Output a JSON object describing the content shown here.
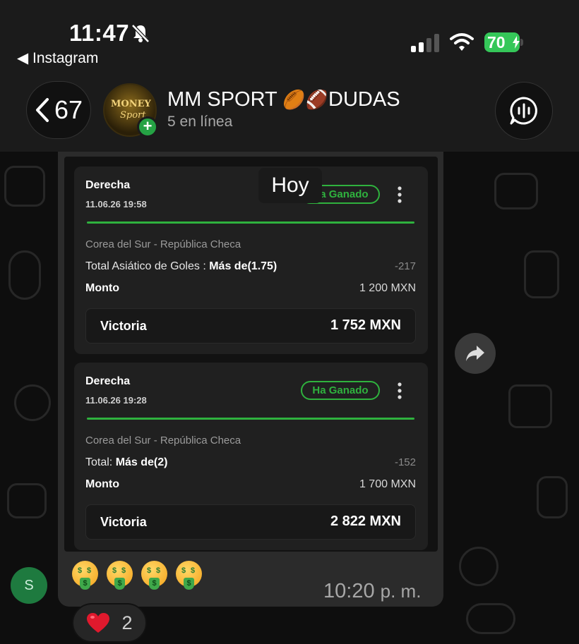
{
  "status_bar": {
    "time": "11:47",
    "back_app": "◀ Instagram",
    "battery": "70"
  },
  "chat_header": {
    "back_count": "67",
    "group_name": "MM SPORT",
    "group_emojis": "🏉🏈",
    "group_name_suffix": "DUDAS",
    "subtitle": "5 en línea",
    "avatar_text_1": "MONEY",
    "avatar_text_2": "Sport"
  },
  "date_separator": "Hoy",
  "bets": [
    {
      "type": "Derecha",
      "datetime": "11.06.26 19:58",
      "status": "Ha Ganado",
      "match": "Corea del Sur - República Checa",
      "market_label": "Total Asiático de Goles",
      "market_value": "Más de(1.75)",
      "odds": "-217",
      "stake_label": "Monto",
      "stake_value": "1 200 MXN",
      "win_label": "Victoria",
      "win_value": "1 752 MXN"
    },
    {
      "type": "Derecha",
      "datetime": "11.06.26 19:28",
      "status": "Ha Ganado",
      "match": "Corea del Sur - República Checa",
      "market_label": "Total",
      "market_value": "Más de(2)",
      "odds": "-152",
      "stake_label": "Monto",
      "stake_value": "1 700 MXN",
      "win_label": "Victoria",
      "win_value": "2 822 MXN"
    }
  ],
  "message": {
    "time": "10:20",
    "ampm": "p. m.",
    "sender_initial": "S",
    "reaction_emoji": "heart",
    "reaction_count": "2"
  },
  "colors": {
    "accent_green": "#2fb23e",
    "battery_green": "#35c759",
    "header_bg": "#1b1b1b",
    "bubble_bg": "#2b2b2b"
  }
}
